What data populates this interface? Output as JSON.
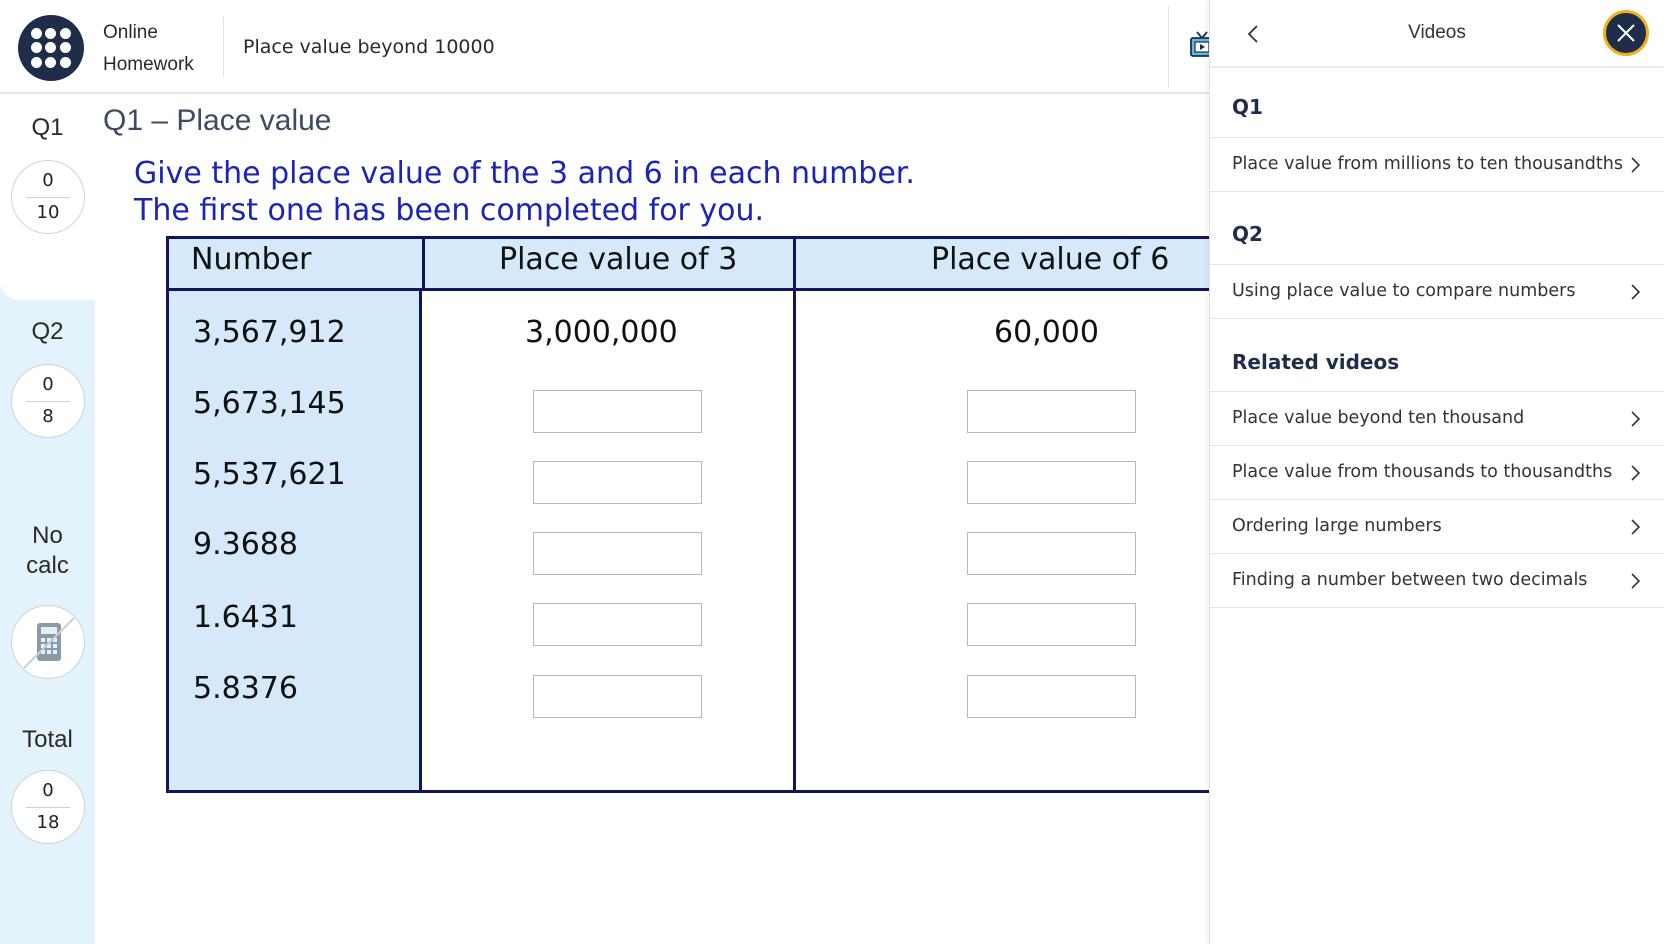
{
  "topbar": {
    "brand_line1": "Online",
    "brand_line2": "Homework",
    "title": "Place value beyond 10000",
    "apps_icon": "grid-icon",
    "video_icon": "tv-icon"
  },
  "rail": {
    "q1": {
      "label": "Q1",
      "score": "0",
      "max": "10"
    },
    "q2": {
      "label": "Q2",
      "score": "0",
      "max": "8"
    },
    "calc": {
      "line1": "No",
      "line2": "calc",
      "icon": "calculator-disabled-icon"
    },
    "total": {
      "label": "Total",
      "score": "0",
      "max": "18"
    }
  },
  "question": {
    "heading": "Q1 – Place value",
    "instruction1": "Give the place value of the 3 and 6 in each number.",
    "instruction2": "The first one has been completed for you.",
    "headers": [
      "Number",
      "Place value of 3",
      "Place value of 6"
    ],
    "rows": [
      {
        "number": "3,567,912",
        "pv3": "3,000,000",
        "pv6": "60,000",
        "completed": true
      },
      {
        "number": "5,673,145",
        "pv3": "",
        "pv6": "",
        "completed": false
      },
      {
        "number": "5,537,621",
        "pv3": "",
        "pv6": "",
        "completed": false
      },
      {
        "number": "9.3688",
        "pv3": "",
        "pv6": "",
        "completed": false
      },
      {
        "number": "1.6431",
        "pv3": "",
        "pv6": "",
        "completed": false
      },
      {
        "number": "5.8376",
        "pv3": "",
        "pv6": "",
        "completed": false
      }
    ]
  },
  "videos_panel": {
    "title": "Videos",
    "sections": [
      {
        "title": "Q1",
        "items": [
          "Place value from millions to ten thousandths"
        ]
      },
      {
        "title": "Q2",
        "items": [
          "Using place value to compare numbers"
        ]
      },
      {
        "title": "Related videos",
        "items": [
          "Place value beyond ten thousand",
          "Place value from thousands to thousandths",
          "Ordering large numbers",
          "Finding a number between two decimals"
        ]
      }
    ]
  },
  "colors": {
    "navy": "#1f2d4a",
    "instruction_blue": "#1a25b8",
    "table_border": "#10155e",
    "number_col_bg": "#d6e9fb",
    "rail_bg": "#e4f2fb",
    "close_ring": "#f2b01e"
  }
}
